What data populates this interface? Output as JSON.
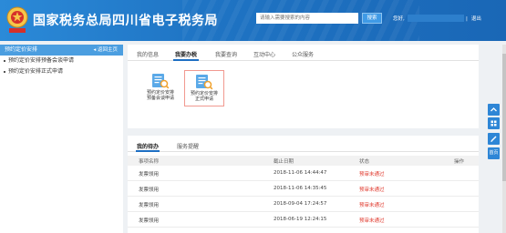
{
  "header": {
    "title": "国家税务总局四川省电子税务局",
    "search_placeholder": "请输入需要搜索的内容",
    "search_button": "搜索",
    "welcome": "您好,",
    "logout": "退出",
    "logout_sep": "|"
  },
  "sidebar": {
    "title": "预约定价安排",
    "back_label": "返回主页",
    "items": [
      {
        "label": "预约定价安排预备会谈申请"
      },
      {
        "label": "预约定价安排正式申请"
      }
    ]
  },
  "main": {
    "tabs": [
      {
        "label": "我的信息"
      },
      {
        "label": "我要办税"
      },
      {
        "label": "我要查询"
      },
      {
        "label": "互动中心"
      },
      {
        "label": "公众服务"
      }
    ],
    "apps": [
      {
        "line1": "预约定价安排",
        "line2": "预备会谈申请"
      },
      {
        "line1": "预约定价安排",
        "line2": "正式申请"
      }
    ],
    "tasks_tabs": [
      {
        "label": "我的待办"
      },
      {
        "label": "服务提醒"
      }
    ],
    "table": {
      "headers": [
        "事项名称",
        "截止日期",
        "状态",
        "操作"
      ],
      "rows": [
        {
          "name": "发票领用",
          "date": "2018-11-06 14:44:47",
          "status": "预审未通过"
        },
        {
          "name": "发票领用",
          "date": "2018-11-06 14:35:45",
          "status": "预审未通过"
        },
        {
          "name": "发票领用",
          "date": "2018-09-04 17:24:57",
          "status": "预审未通过"
        },
        {
          "name": "发票领用",
          "date": "2018-06-19 12:24:15",
          "status": "预审未通过"
        }
      ]
    }
  },
  "tools": {
    "top_icon": "chevron-up-icon",
    "grid_icon": "grid-icon",
    "edit_icon": "edit-icon",
    "home_label": "首页"
  },
  "colors": {
    "header_blue": "#1f74c4",
    "accent_blue": "#1e6fc3",
    "status_red": "#e03b2f",
    "sidebar_head": "#4b9ee0"
  }
}
